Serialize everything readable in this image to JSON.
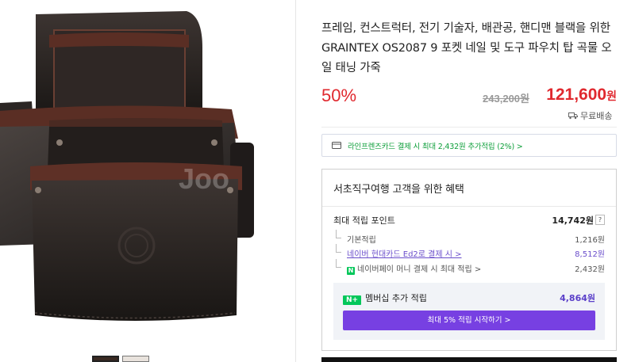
{
  "product": {
    "title": "프레임, 컨스트럭터, 전기 기술자, 배관공, 핸디맨 블랙을 위한 GRAINTEX OS2087 9 포켓 네일 및 도구 파우치 탑 곡물 오일 태닝 가죽",
    "image_watermark": "Joo"
  },
  "price": {
    "discount": "50%",
    "original": "243,200원",
    "sale_number": "121,600",
    "sale_unit": "원"
  },
  "delivery": {
    "label": "무료배송",
    "icon": "truck-icon"
  },
  "card_banner": {
    "icon": "card-icon",
    "text": "라인프렌즈카드 결제 시 최대 2,432원 추가적립 (2%) >"
  },
  "benefits": {
    "title": "서초직구여행 고객을 위한 혜택",
    "max_label": "최대 적립 포인트",
    "max_value": "14,742원",
    "help": "?",
    "rows": [
      {
        "label": "기본적립",
        "value": "1,216원"
      },
      {
        "label": "네이버 현대카드 Ed2로 결제 시 >",
        "value": "8,512원"
      },
      {
        "label": "네이버페이 머니 결제 시 최대 적립 >",
        "value": "2,432원"
      }
    ],
    "npay_badge": "N",
    "membership": {
      "badge": "N+",
      "label": "멤버십 추가 적립",
      "value": "4,864원",
      "button": "최대 5% 적립 시작하기 >"
    }
  },
  "colors": {
    "sale_red": "#e0282e",
    "naver_green": "#03c75a",
    "membership_purple": "#7740e2"
  }
}
